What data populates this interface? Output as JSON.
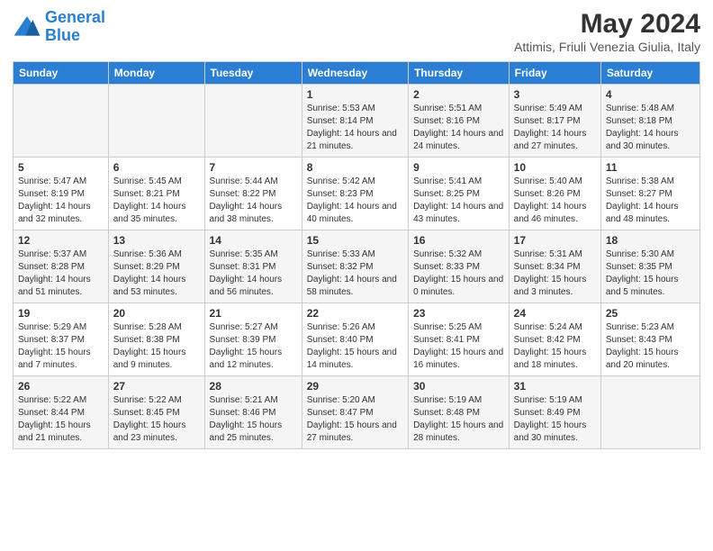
{
  "logo": {
    "line1": "General",
    "line2": "Blue"
  },
  "title": "May 2024",
  "subtitle": "Attimis, Friuli Venezia Giulia, Italy",
  "days_of_week": [
    "Sunday",
    "Monday",
    "Tuesday",
    "Wednesday",
    "Thursday",
    "Friday",
    "Saturday"
  ],
  "weeks": [
    [
      {
        "day": "",
        "sunrise": "",
        "sunset": "",
        "daylight": ""
      },
      {
        "day": "",
        "sunrise": "",
        "sunset": "",
        "daylight": ""
      },
      {
        "day": "",
        "sunrise": "",
        "sunset": "",
        "daylight": ""
      },
      {
        "day": "1",
        "sunrise": "Sunrise: 5:53 AM",
        "sunset": "Sunset: 8:14 PM",
        "daylight": "Daylight: 14 hours and 21 minutes."
      },
      {
        "day": "2",
        "sunrise": "Sunrise: 5:51 AM",
        "sunset": "Sunset: 8:16 PM",
        "daylight": "Daylight: 14 hours and 24 minutes."
      },
      {
        "day": "3",
        "sunrise": "Sunrise: 5:49 AM",
        "sunset": "Sunset: 8:17 PM",
        "daylight": "Daylight: 14 hours and 27 minutes."
      },
      {
        "day": "4",
        "sunrise": "Sunrise: 5:48 AM",
        "sunset": "Sunset: 8:18 PM",
        "daylight": "Daylight: 14 hours and 30 minutes."
      }
    ],
    [
      {
        "day": "5",
        "sunrise": "Sunrise: 5:47 AM",
        "sunset": "Sunset: 8:19 PM",
        "daylight": "Daylight: 14 hours and 32 minutes."
      },
      {
        "day": "6",
        "sunrise": "Sunrise: 5:45 AM",
        "sunset": "Sunset: 8:21 PM",
        "daylight": "Daylight: 14 hours and 35 minutes."
      },
      {
        "day": "7",
        "sunrise": "Sunrise: 5:44 AM",
        "sunset": "Sunset: 8:22 PM",
        "daylight": "Daylight: 14 hours and 38 minutes."
      },
      {
        "day": "8",
        "sunrise": "Sunrise: 5:42 AM",
        "sunset": "Sunset: 8:23 PM",
        "daylight": "Daylight: 14 hours and 40 minutes."
      },
      {
        "day": "9",
        "sunrise": "Sunrise: 5:41 AM",
        "sunset": "Sunset: 8:25 PM",
        "daylight": "Daylight: 14 hours and 43 minutes."
      },
      {
        "day": "10",
        "sunrise": "Sunrise: 5:40 AM",
        "sunset": "Sunset: 8:26 PM",
        "daylight": "Daylight: 14 hours and 46 minutes."
      },
      {
        "day": "11",
        "sunrise": "Sunrise: 5:38 AM",
        "sunset": "Sunset: 8:27 PM",
        "daylight": "Daylight: 14 hours and 48 minutes."
      }
    ],
    [
      {
        "day": "12",
        "sunrise": "Sunrise: 5:37 AM",
        "sunset": "Sunset: 8:28 PM",
        "daylight": "Daylight: 14 hours and 51 minutes."
      },
      {
        "day": "13",
        "sunrise": "Sunrise: 5:36 AM",
        "sunset": "Sunset: 8:29 PM",
        "daylight": "Daylight: 14 hours and 53 minutes."
      },
      {
        "day": "14",
        "sunrise": "Sunrise: 5:35 AM",
        "sunset": "Sunset: 8:31 PM",
        "daylight": "Daylight: 14 hours and 56 minutes."
      },
      {
        "day": "15",
        "sunrise": "Sunrise: 5:33 AM",
        "sunset": "Sunset: 8:32 PM",
        "daylight": "Daylight: 14 hours and 58 minutes."
      },
      {
        "day": "16",
        "sunrise": "Sunrise: 5:32 AM",
        "sunset": "Sunset: 8:33 PM",
        "daylight": "Daylight: 15 hours and 0 minutes."
      },
      {
        "day": "17",
        "sunrise": "Sunrise: 5:31 AM",
        "sunset": "Sunset: 8:34 PM",
        "daylight": "Daylight: 15 hours and 3 minutes."
      },
      {
        "day": "18",
        "sunrise": "Sunrise: 5:30 AM",
        "sunset": "Sunset: 8:35 PM",
        "daylight": "Daylight: 15 hours and 5 minutes."
      }
    ],
    [
      {
        "day": "19",
        "sunrise": "Sunrise: 5:29 AM",
        "sunset": "Sunset: 8:37 PM",
        "daylight": "Daylight: 15 hours and 7 minutes."
      },
      {
        "day": "20",
        "sunrise": "Sunrise: 5:28 AM",
        "sunset": "Sunset: 8:38 PM",
        "daylight": "Daylight: 15 hours and 9 minutes."
      },
      {
        "day": "21",
        "sunrise": "Sunrise: 5:27 AM",
        "sunset": "Sunset: 8:39 PM",
        "daylight": "Daylight: 15 hours and 12 minutes."
      },
      {
        "day": "22",
        "sunrise": "Sunrise: 5:26 AM",
        "sunset": "Sunset: 8:40 PM",
        "daylight": "Daylight: 15 hours and 14 minutes."
      },
      {
        "day": "23",
        "sunrise": "Sunrise: 5:25 AM",
        "sunset": "Sunset: 8:41 PM",
        "daylight": "Daylight: 15 hours and 16 minutes."
      },
      {
        "day": "24",
        "sunrise": "Sunrise: 5:24 AM",
        "sunset": "Sunset: 8:42 PM",
        "daylight": "Daylight: 15 hours and 18 minutes."
      },
      {
        "day": "25",
        "sunrise": "Sunrise: 5:23 AM",
        "sunset": "Sunset: 8:43 PM",
        "daylight": "Daylight: 15 hours and 20 minutes."
      }
    ],
    [
      {
        "day": "26",
        "sunrise": "Sunrise: 5:22 AM",
        "sunset": "Sunset: 8:44 PM",
        "daylight": "Daylight: 15 hours and 21 minutes."
      },
      {
        "day": "27",
        "sunrise": "Sunrise: 5:22 AM",
        "sunset": "Sunset: 8:45 PM",
        "daylight": "Daylight: 15 hours and 23 minutes."
      },
      {
        "day": "28",
        "sunrise": "Sunrise: 5:21 AM",
        "sunset": "Sunset: 8:46 PM",
        "daylight": "Daylight: 15 hours and 25 minutes."
      },
      {
        "day": "29",
        "sunrise": "Sunrise: 5:20 AM",
        "sunset": "Sunset: 8:47 PM",
        "daylight": "Daylight: 15 hours and 27 minutes."
      },
      {
        "day": "30",
        "sunrise": "Sunrise: 5:19 AM",
        "sunset": "Sunset: 8:48 PM",
        "daylight": "Daylight: 15 hours and 28 minutes."
      },
      {
        "day": "31",
        "sunrise": "Sunrise: 5:19 AM",
        "sunset": "Sunset: 8:49 PM",
        "daylight": "Daylight: 15 hours and 30 minutes."
      },
      {
        "day": "",
        "sunrise": "",
        "sunset": "",
        "daylight": ""
      }
    ]
  ]
}
